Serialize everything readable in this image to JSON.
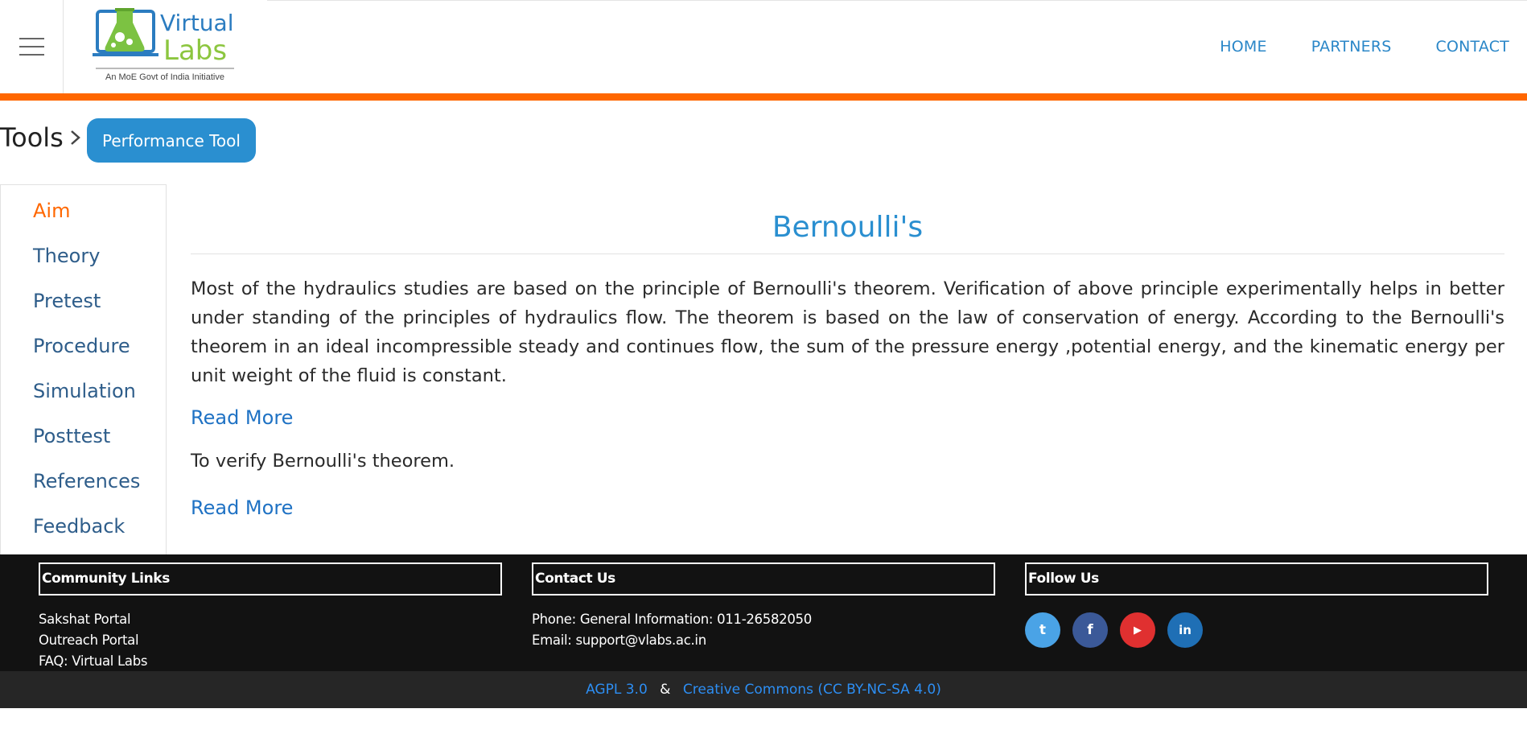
{
  "header": {
    "logo": {
      "line1": "Virtual",
      "line2": "Labs",
      "tagline": "An MoE Govt of India Initiative"
    },
    "nav": [
      "HOME",
      "PARTNERS",
      "CONTACT"
    ]
  },
  "breadcrumb": {
    "title": "Tools",
    "button": "Performance Tool"
  },
  "sidebar": {
    "items": [
      {
        "label": "Aim",
        "active": true
      },
      {
        "label": "Theory"
      },
      {
        "label": "Pretest"
      },
      {
        "label": "Procedure"
      },
      {
        "label": "Simulation"
      },
      {
        "label": "Posttest"
      },
      {
        "label": "References"
      },
      {
        "label": "Feedback"
      }
    ]
  },
  "main": {
    "title": "Bernoulli's",
    "intro": "Most of the hydraulics studies are based on the principle of Bernoulli's theorem. Verification of above principle experimentally helps in better under standing of the principles of hydraulics flow. The theorem is based on the law of conservation of energy. According to the Bernoulli's theorem in an ideal incompressible steady and continues flow, the sum of the pressure energy ,potential energy, and the kinematic energy per unit weight of the fluid is constant.",
    "read_more_1": "Read More",
    "aim": "To verify Bernoulli's theorem.",
    "read_more_2": "Read More"
  },
  "footer": {
    "community": {
      "heading": "Community Links",
      "links": [
        "Sakshat Portal",
        "Outreach Portal",
        "FAQ: Virtual Labs"
      ]
    },
    "contact": {
      "heading": "Contact Us",
      "phone": "Phone: General Information: 011-26582050",
      "email": "Email: support@vlabs.ac.in"
    },
    "follow": {
      "heading": "Follow Us",
      "icons": [
        {
          "name": "twitter-icon",
          "glyph": "t",
          "color": "#4aa3e6"
        },
        {
          "name": "facebook-icon",
          "glyph": "f",
          "color": "#3b5998"
        },
        {
          "name": "youtube-icon",
          "glyph": "▶",
          "color": "#e03030"
        },
        {
          "name": "linkedin-icon",
          "glyph": "in",
          "color": "#1f6fb5"
        }
      ]
    }
  },
  "bottom_bar": {
    "license1": "AGPL 3.0",
    "separator": "&",
    "license2": "Creative Commons (CC BY-NC-SA 4.0)"
  },
  "colors": {
    "accent": "#ff6700",
    "link_blue": "#2a8fd0",
    "sidebar_text": "#2e5d8a",
    "footer_bg": "#121212"
  }
}
